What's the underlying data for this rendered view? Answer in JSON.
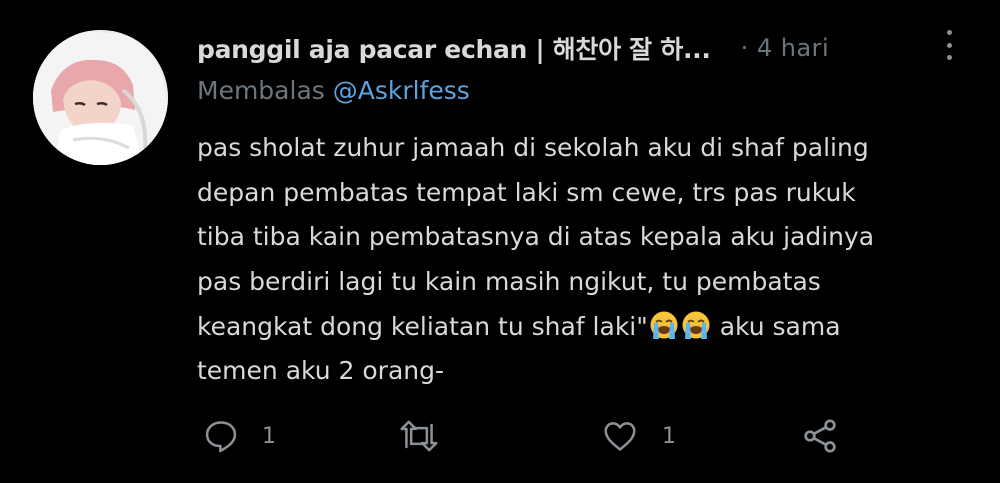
{
  "tweet": {
    "author": {
      "display_name": "panggil aja pacar echan | 해찬아 잘 하...",
      "avatar_icon": "profile-photo"
    },
    "time": "· 4 hari",
    "reply": {
      "prefix": "Membalas",
      "mention": "@Askrlfess"
    },
    "text_lines": [
      "pas sholat zuhur jamaah di sekolah aku di shaf paling",
      "depan pembatas tempat laki sm cewe, trs pas rukuk",
      "tiba tiba kain pembatasnya di atas kepala aku jadinya",
      "pas berdiri lagi tu kain masih ngikut, tu pembatas",
      "keangkat dong keliatan tu shaf laki\"",
      " aku sama",
      "temen aku 2 orang-"
    ],
    "emojis": [
      "loudly-crying-face-emoji",
      "loudly-crying-face-emoji"
    ],
    "actions": {
      "reply": {
        "icon": "reply-icon",
        "count": "1"
      },
      "retweet": {
        "icon": "retweet-icon",
        "count": ""
      },
      "like": {
        "icon": "heart-icon",
        "count": "1"
      },
      "share": {
        "icon": "share-icon"
      }
    },
    "more_icon": "more-options-icon"
  },
  "colors": {
    "background": "#000000",
    "primary_text": "#d9d9d9",
    "secondary_text": "#6e767d",
    "mention": "#5ba4e0",
    "icon": "#8b9196"
  }
}
